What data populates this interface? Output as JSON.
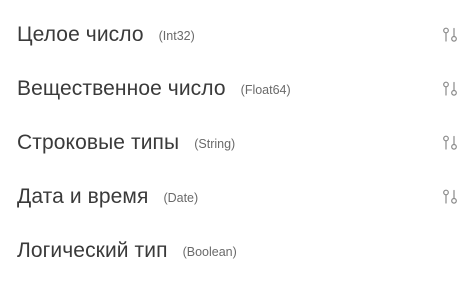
{
  "types": [
    {
      "label": "Целое число",
      "code": "(Int32)",
      "sort_icon": "sort-icon"
    },
    {
      "label": "Вещественное число",
      "code": "(Float64)",
      "sort_icon": "sort-icon"
    },
    {
      "label": "Строковые типы",
      "code": "(String)",
      "sort_icon": "sort-icon"
    },
    {
      "label": "Дата и время",
      "code": "(Date)",
      "sort_icon": "sort-icon"
    },
    {
      "label": "Логический тип",
      "code": "(Boolean)"
    }
  ],
  "colors": {
    "text": "#3a3a3a",
    "code_text": "#6a6a6a",
    "icon": "#8a8a8a",
    "background": "#ffffff"
  }
}
